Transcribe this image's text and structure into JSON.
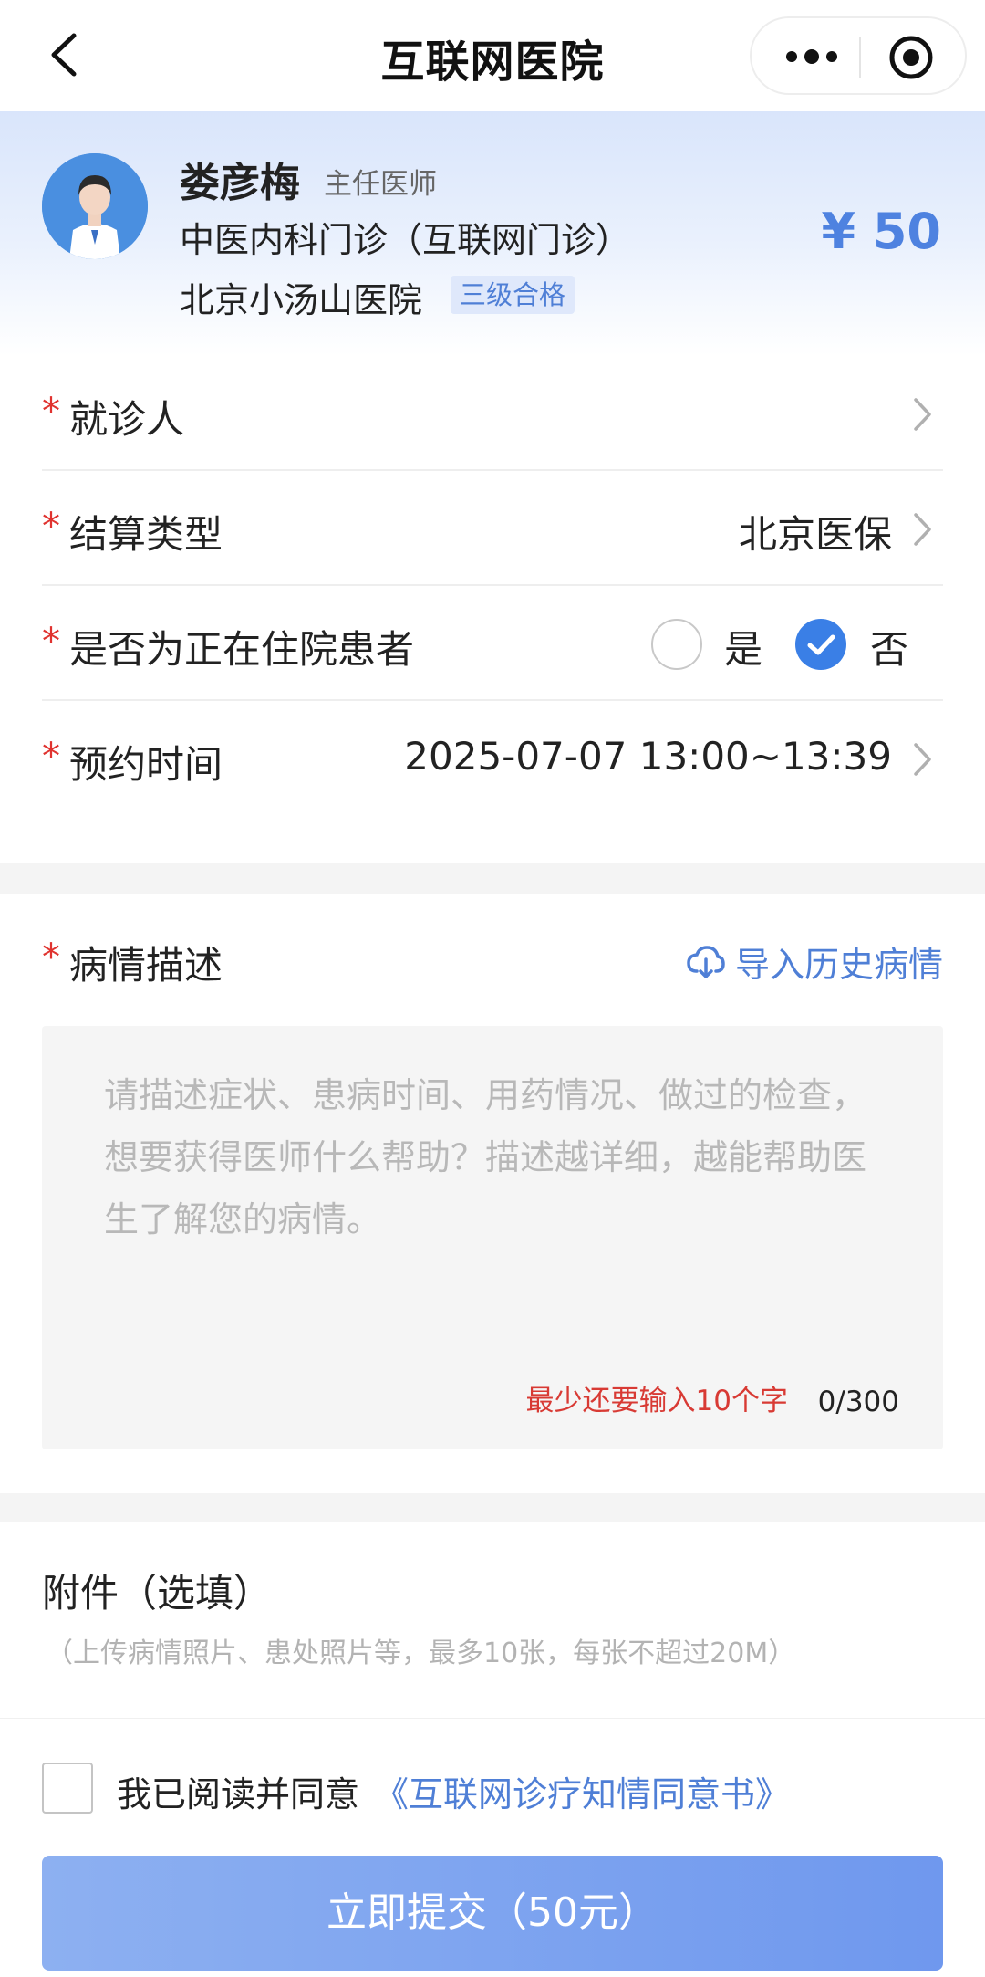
{
  "nav": {
    "title": "互联网医院"
  },
  "doctor": {
    "name": "娄彦梅",
    "title": "主任医师",
    "department": "中医内科门诊（互联网门诊）",
    "hospital": "北京小汤山医院",
    "hospital_badge": "三级合格",
    "price": "¥ 50"
  },
  "form": {
    "patient": {
      "required_mark": "*",
      "label": "就诊人",
      "value": ""
    },
    "settlement": {
      "required_mark": "*",
      "label": "结算类型",
      "value": "北京医保"
    },
    "inpatient": {
      "required_mark": "*",
      "label": "是否为正在住院患者",
      "option_yes": "是",
      "option_no": "否",
      "selected": "否"
    },
    "appointment": {
      "required_mark": "*",
      "label": "预约时间",
      "value": "2025-07-07 13:00~13:39"
    }
  },
  "description": {
    "required_mark": "*",
    "label": "病情描述",
    "import_label": "导入历史病情",
    "placeholder": "请描述症状、患病时间、用药情况、做过的检查，想要获得医师什么帮助？描述越详细，越能帮助医生了解您的病情。",
    "warning": "最少还要输入10个字",
    "count": "0/300"
  },
  "attachment": {
    "title": "附件（选填）",
    "subtitle": "（上传病情照片、患处照片等，最多10张，每张不超过20M）"
  },
  "footer": {
    "agree_text": "我已阅读并同意",
    "agree_link": "《互联网诊疗知情同意书》",
    "submit_label": "立即提交（50元）"
  },
  "colors": {
    "accent": "#4f7fd6",
    "required": "#e0332f",
    "radio_selected": "#3a7fe6"
  }
}
